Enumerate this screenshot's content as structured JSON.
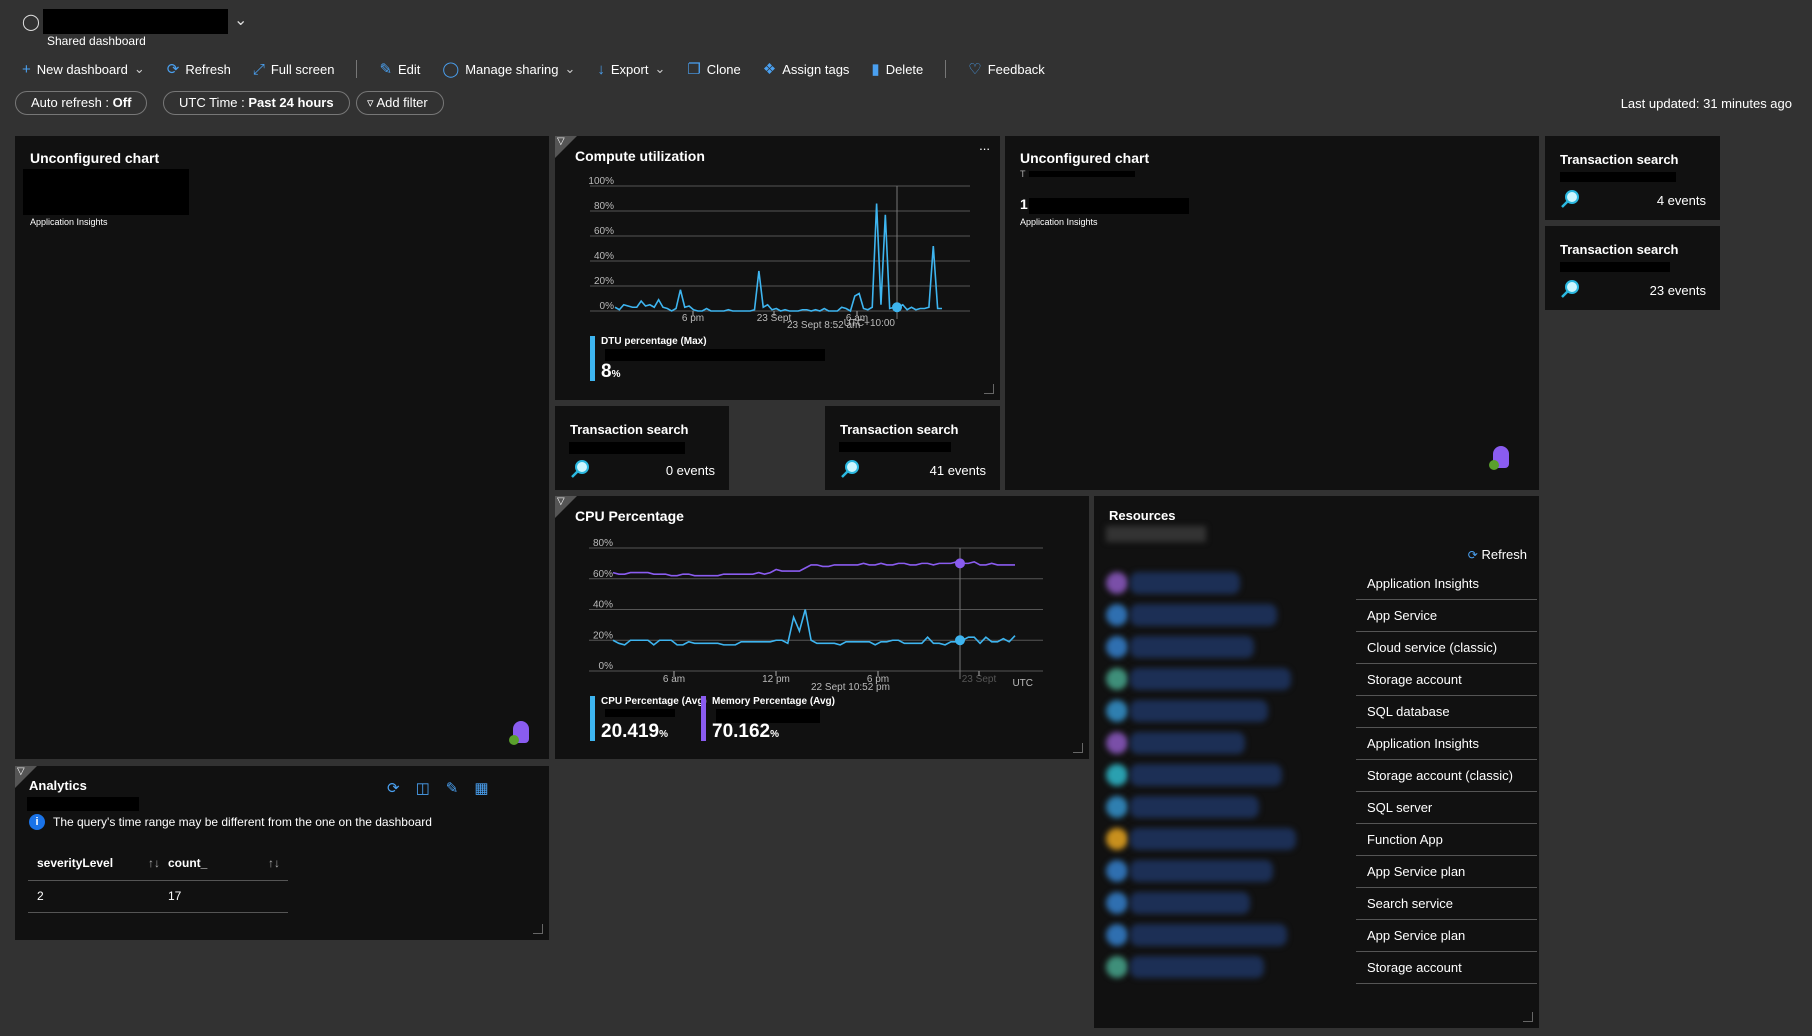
{
  "header": {
    "subtitle": "Shared dashboard",
    "icon": "people-icon"
  },
  "toolbar": [
    {
      "label": "New dashboard",
      "icon": "plus-icon",
      "dropdown": true
    },
    {
      "label": "Refresh",
      "icon": "refresh-icon"
    },
    {
      "label": "Full screen",
      "icon": "fullscreen-icon"
    },
    {
      "label": "Edit",
      "icon": "pencil-icon",
      "sep_before": true
    },
    {
      "label": "Manage sharing",
      "icon": "people-icon",
      "dropdown": true
    },
    {
      "label": "Export",
      "icon": "download-icon",
      "dropdown": true
    },
    {
      "label": "Clone",
      "icon": "copy-icon"
    },
    {
      "label": "Assign tags",
      "icon": "tag-icon"
    },
    {
      "label": "Delete",
      "icon": "trash-icon"
    },
    {
      "label": "Feedback",
      "icon": "heart-icon",
      "sep_before": true
    }
  ],
  "filters": {
    "auto_refresh_label": "Auto refresh : ",
    "auto_refresh_value": "Off",
    "time_label": "UTC Time : ",
    "time_value": "Past 24 hours",
    "add_filter": "Add filter"
  },
  "last_updated": "Last updated: 31 minutes ago",
  "tiles": {
    "unconfigured1": {
      "title": "Unconfigured chart",
      "source": "Application Insights"
    },
    "unconfigured2": {
      "title": "Unconfigured chart",
      "prefix": "T",
      "value_prefix": "1",
      "source": "Application Insights"
    },
    "ts1": {
      "title": "Transaction search",
      "count": "4 events"
    },
    "ts2": {
      "title": "Transaction search",
      "count": "23 events"
    },
    "ts3": {
      "title": "Transaction search",
      "count": "0 events"
    },
    "ts4": {
      "title": "Transaction search",
      "count": "41 events"
    },
    "compute": {
      "title": "Compute utilization",
      "more": "...",
      "legend": {
        "name": "DTU percentage (Max)",
        "value": "8",
        "unit": "%"
      }
    },
    "cpu": {
      "title": "CPU Percentage",
      "legend": [
        {
          "name": "CPU Percentage (Avg)",
          "value": "20.419",
          "unit": "%"
        },
        {
          "name": "Memory Percentage (Avg)",
          "value": "70.162",
          "unit": "%"
        }
      ]
    },
    "analytics": {
      "title": "Analytics",
      "info": "The query's time range may be different from the one on the dashboard",
      "columns": [
        "severityLevel",
        "count_"
      ],
      "rows": [
        [
          "2",
          "17"
        ]
      ]
    },
    "resources": {
      "title": "Resources",
      "refresh": "Refresh",
      "types": [
        "Application Insights",
        "App Service",
        "Cloud service (classic)",
        "Storage account",
        "SQL database",
        "Application Insights",
        "Storage account (classic)",
        "SQL server",
        "Function App",
        "App Service plan",
        "Search service",
        "App Service plan",
        "Storage account"
      ],
      "icon_colors": [
        "#7a4fa8",
        "#2f6fb0",
        "#2f6fb0",
        "#3f8f7a",
        "#2f7fb0",
        "#7a4fa8",
        "#2aa0b0",
        "#2f7fb0",
        "#c8901e",
        "#2f6fb0",
        "#2f6fb0",
        "#2f6fb0",
        "#3f8f7a"
      ]
    }
  },
  "chart_data": [
    {
      "type": "line",
      "title": "Compute utilization",
      "ylim": [
        0,
        100
      ],
      "yticks": [
        "0%",
        "20%",
        "40%",
        "60%",
        "80%",
        "100%"
      ],
      "xticks": [
        "6 pm",
        "23 Sept",
        "6 am"
      ],
      "timezone": "UTC+10:00",
      "hover_label": "23 Sept 8:52 am",
      "grid": true,
      "series": [
        {
          "name": "DTU percentage (Max)",
          "color": "#3eb5f0",
          "values": [
            3,
            1,
            5,
            4,
            3,
            3,
            8,
            4,
            5,
            3,
            9,
            3,
            2,
            0,
            2,
            17,
            3,
            4,
            1,
            0,
            0,
            2,
            0,
            0,
            0,
            0,
            1,
            0,
            0,
            0,
            0,
            0,
            1,
            32,
            3,
            5,
            1,
            2,
            0,
            1,
            0,
            0,
            0,
            1,
            1,
            0,
            1,
            0,
            2,
            0,
            0,
            0,
            3,
            2,
            0,
            12,
            14,
            2,
            1,
            3,
            86,
            5,
            77,
            2,
            3,
            3,
            5,
            1,
            3,
            1,
            2,
            2,
            3,
            52,
            2,
            2
          ]
        }
      ]
    },
    {
      "type": "line",
      "title": "CPU Percentage",
      "ylim": [
        0,
        80
      ],
      "yticks": [
        "0%",
        "20%",
        "40%",
        "60%",
        "80%"
      ],
      "xticks": [
        "6 am",
        "12 pm",
        "6 pm",
        "23 Sept"
      ],
      "timezone": "UTC",
      "hover_label": "22 Sept 10:52 pm",
      "grid": true,
      "series": [
        {
          "name": "CPU Percentage (Avg)",
          "color": "#3eb5f0",
          "values": [
            20,
            18,
            17,
            20,
            20,
            20,
            20,
            17,
            20,
            20,
            20,
            17,
            17,
            19,
            18,
            18,
            18,
            18,
            18,
            17,
            17,
            17,
            19,
            19,
            19,
            19,
            19,
            19,
            20,
            20,
            18,
            35,
            26,
            40,
            20,
            18,
            18,
            18,
            18,
            17,
            19,
            19,
            19,
            19,
            19,
            17,
            19,
            19,
            20,
            20,
            18,
            18,
            18,
            18,
            22,
            18,
            18,
            17,
            19,
            19,
            20,
            22,
            22,
            18,
            22,
            19,
            19,
            21,
            19,
            23
          ]
        },
        {
          "name": "Memory Percentage (Avg)",
          "color": "#8a5cf0",
          "values": [
            64,
            63,
            63,
            64,
            64,
            64,
            64,
            63,
            63,
            63,
            62,
            62,
            63,
            63,
            62,
            62,
            62,
            62,
            62,
            63,
            63,
            63,
            63,
            63,
            63,
            64,
            63,
            64,
            66,
            65,
            65,
            65,
            65,
            67,
            69,
            69,
            68,
            68,
            69,
            69,
            69,
            69,
            69,
            70,
            69,
            69,
            70,
            69,
            69,
            70,
            70,
            69,
            69,
            70,
            70,
            69,
            70,
            70,
            70,
            71,
            70,
            70,
            71,
            69,
            69,
            70,
            69,
            69,
            69,
            69
          ]
        }
      ]
    }
  ]
}
